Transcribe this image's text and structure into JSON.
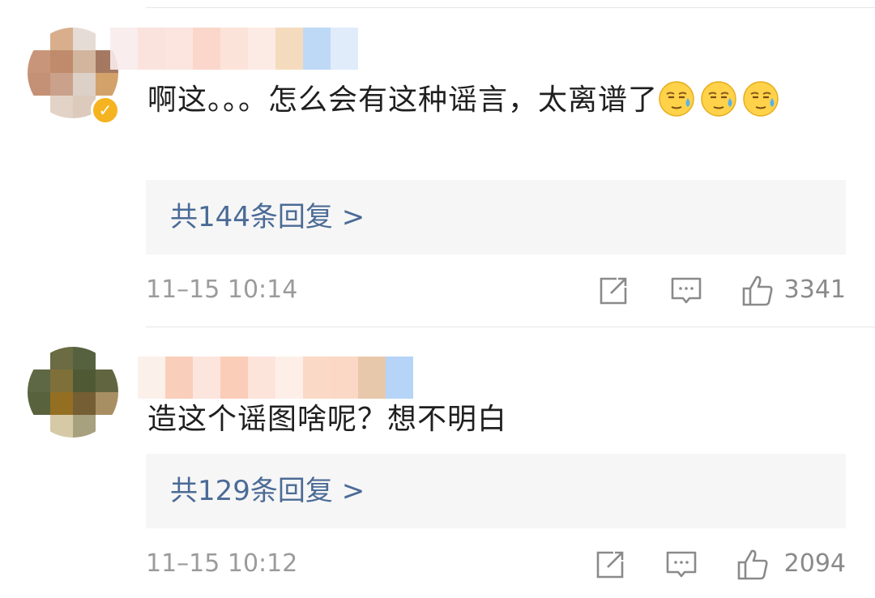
{
  "comments": [
    {
      "text": "啊这。。。怎么会有这种谣言，太离谱了",
      "emoji": [
        "sweat-face-icon",
        "sweat-face-icon",
        "sweat-face-icon"
      ],
      "reply_label": "共144条回复 >",
      "timestamp": "11–15 10:14",
      "likes": "3341"
    },
    {
      "text": "造这个谣图啥呢？想不明白",
      "emoji": [],
      "reply_label": "共129条回复 >",
      "timestamp": "11–15 10:12",
      "likes": "2094"
    }
  ],
  "colors": {
    "reply_link": "#4b6b96",
    "meta_text": "#9b9b9b",
    "reply_bg": "#f6f6f6",
    "verified_badge": "#f5b320"
  }
}
